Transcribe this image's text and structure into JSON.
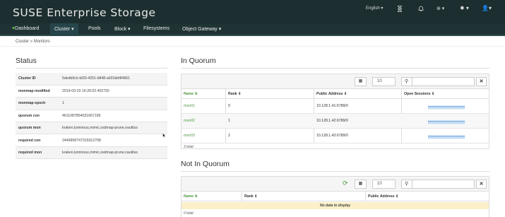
{
  "app": {
    "title": "SUSE Enterprise Storage"
  },
  "topbar": {
    "language": "English",
    "language_caret": "▾",
    "icons": [
      "hourglass-icon",
      "bell-icon",
      "help-icon",
      "settings-icon",
      "user-icon"
    ]
  },
  "nav": {
    "items": [
      {
        "label": "Dashboard",
        "icon": "heart-icon"
      },
      {
        "label": "Cluster ▾"
      },
      {
        "label": "Pools"
      },
      {
        "label": "Block ▾"
      },
      {
        "label": "Filesystems"
      },
      {
        "label": "Object Gateway ▾"
      }
    ]
  },
  "breadcrumb": {
    "parent": "Cluster",
    "sep": "»",
    "current": "Monitors"
  },
  "status": {
    "title": "Status",
    "rows": [
      {
        "key": "Cluster ID",
        "value": "5dedb9cb-bf33-4251-b848-a931bbf84961"
      },
      {
        "key": "monmap modified",
        "value": "2019-03-20 16:26:02.402792"
      },
      {
        "key": "monmap epoch",
        "value": "1"
      },
      {
        "key": "quorum con",
        "value": "4611087854031667199"
      },
      {
        "key": "quorum mon",
        "value": "kraken,luminous,mimic,osdmap-prune,nautilus"
      },
      {
        "key": "required con",
        "value": "2449958747315912708"
      },
      {
        "key": "required mon",
        "value": "kraken,luminous,mimic,osdmap-prune,nautilus"
      }
    ]
  },
  "in_quorum": {
    "title": "In Quorum",
    "page_size": "10",
    "columns": {
      "name": "Name",
      "rank": "Rank",
      "address": "Public Address",
      "sessions": "Open Sessions"
    },
    "sort_icon": "⇅",
    "rows": [
      {
        "name": "mon01",
        "rank": "0",
        "address": "10.128.1.41:6789/0"
      },
      {
        "name": "mon02",
        "rank": "1",
        "address": "10.128.1.42:6789/0"
      },
      {
        "name": "mon03",
        "rank": "2",
        "address": "10.128.1.43:6789/0"
      }
    ],
    "footer": "3 total"
  },
  "not_in_quorum": {
    "title": "Not In Quorum",
    "page_size": "10",
    "columns": {
      "name": "Name",
      "rank": "Rank",
      "address": "Public Address"
    },
    "sort_icon": "⇅",
    "empty": "No data to display",
    "footer": "0 total"
  },
  "colors": {
    "topbar": "#1c2e2f",
    "accent": "#4e9a41",
    "spark": "#4a90d9",
    "empty_bg": "#fbf0c8"
  }
}
